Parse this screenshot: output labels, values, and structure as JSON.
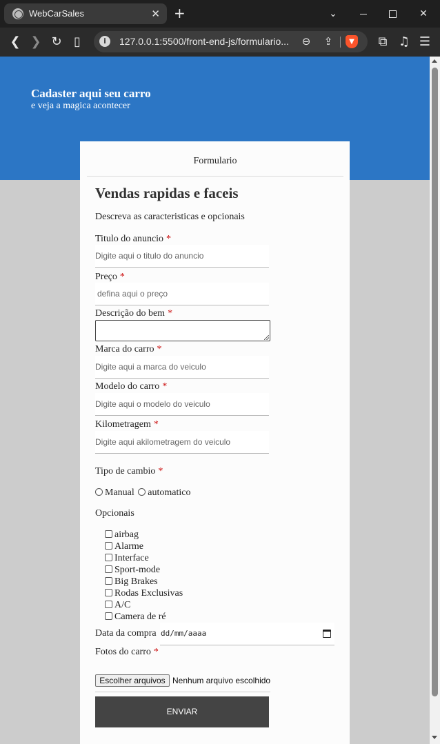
{
  "browser": {
    "tab_title": "WebCarSales",
    "tab_close": "✕",
    "new_tab": "+",
    "url": "127.0.0.1:5500/front-end-js/formulario...",
    "icons": [
      "globe-icon",
      "close-icon",
      "plus-icon",
      "chevron-down-icon",
      "minimize-icon",
      "maximize-icon",
      "window-close-icon",
      "back-icon",
      "forward-icon",
      "reload-icon",
      "bookmark-icon",
      "info-icon",
      "zoom-out-icon",
      "share-icon",
      "brave-shield-icon",
      "extensions-icon",
      "media-icon",
      "menu-icon"
    ]
  },
  "hero": {
    "title": "Cadaster aqui seu carro",
    "subtitle": "e veja a magica acontecer",
    "color": "#2c76c5"
  },
  "form": {
    "header": "Formulario",
    "heading": "Vendas rapidas e faceis",
    "description": "Descreva as caracteristicas e opcionais",
    "required_mark": "*",
    "required_color": "#cc1111",
    "titulo": {
      "label": "Titulo do anuncio",
      "placeholder": "Digite aqui o titulo do anuncio"
    },
    "preco": {
      "label": "Preço",
      "placeholder": "defina aqui o preço"
    },
    "descricao": {
      "label": "Descrição do bem"
    },
    "marca": {
      "label": "Marca do carro",
      "placeholder": "Digite aqui a marca do veiculo"
    },
    "modelo": {
      "label": "Modelo do carro",
      "placeholder": "Digite aqui o modelo do veiculo"
    },
    "km": {
      "label": "Kilometragem",
      "placeholder": "Digite aqui akilometragem do veiculo"
    },
    "cambio": {
      "label": "Tipo de cambio",
      "options": [
        "Manual",
        "automatico"
      ]
    },
    "opcionais": {
      "label": "Opcionais",
      "items": [
        "airbag",
        "Alarme",
        "Interface",
        "Sport-mode",
        "Big Brakes",
        "Rodas Exclusivas",
        "A/C",
        "Camera de ré"
      ]
    },
    "data_compra": {
      "label": "Data da compra",
      "value": "dd/mm/aaaa"
    },
    "fotos": {
      "label": "Fotos do carro",
      "button": "Escolher arquivos",
      "status": "Nenhum arquivo escolhido"
    },
    "submit": "ENVIAR",
    "submit_color": "#444444"
  }
}
